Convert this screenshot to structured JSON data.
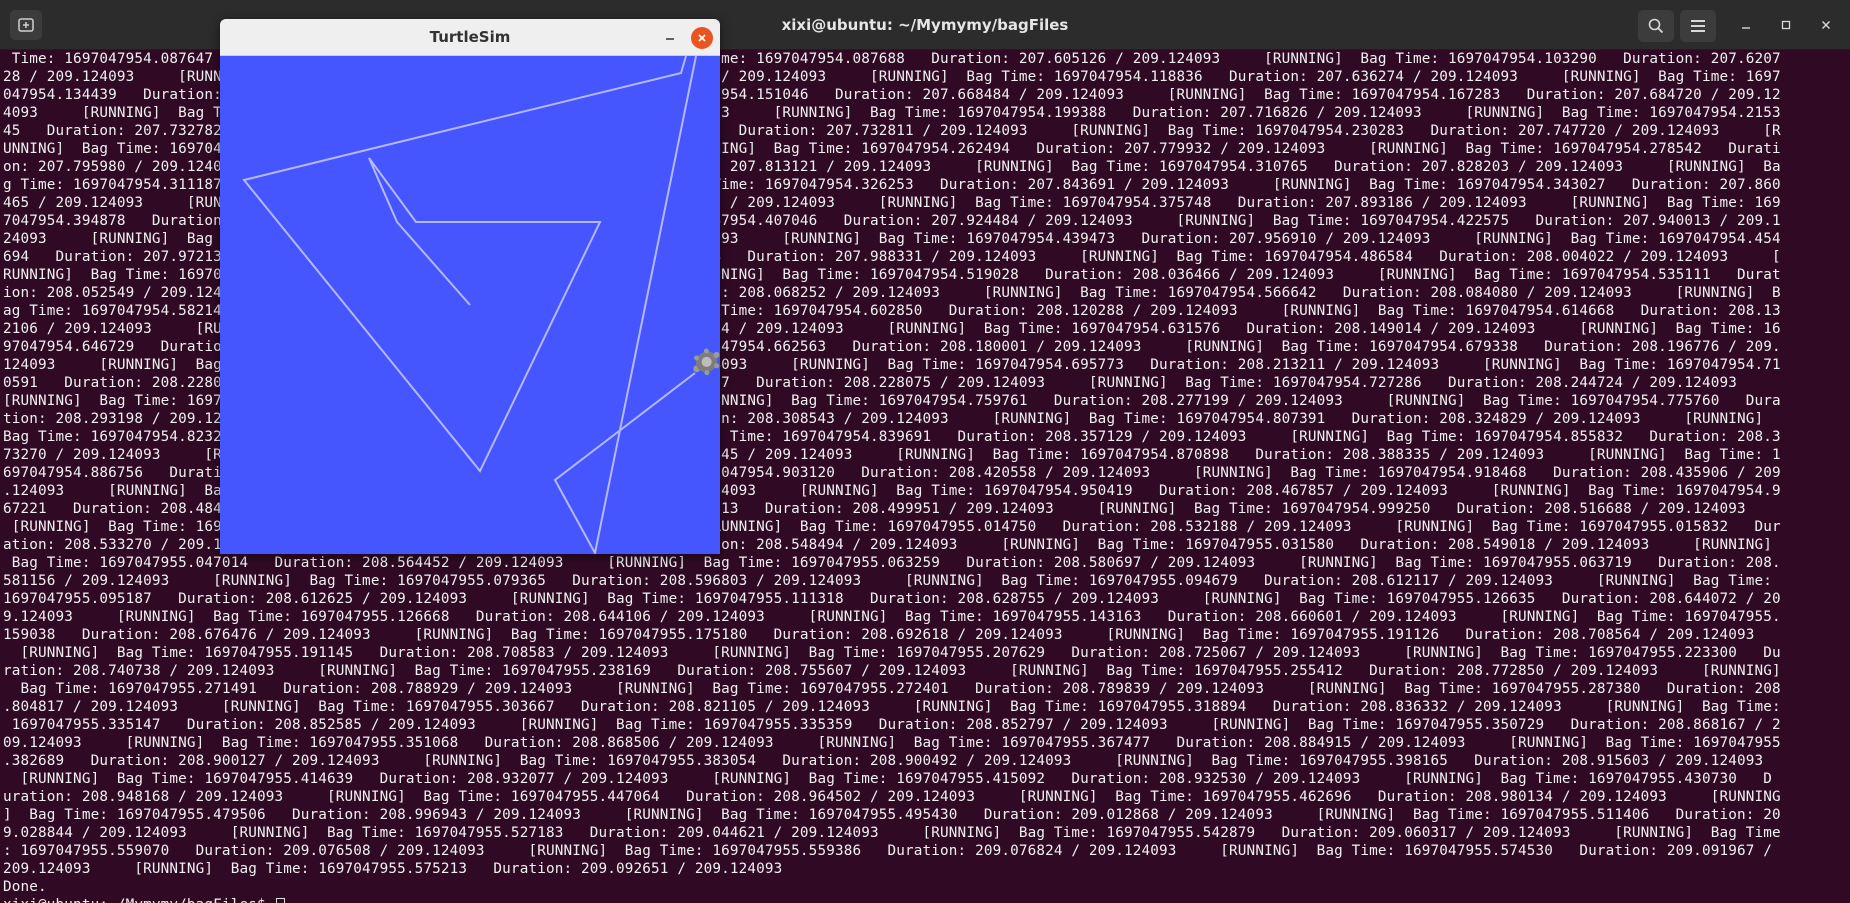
{
  "terminal": {
    "title": "xixi@ubuntu: ~/Mymymy/bagFiles",
    "icons": {
      "new_tab": "new-tab-icon",
      "search": "search-icon",
      "menu": "hamburger-menu-icon",
      "minimize": "minimize-icon",
      "maximize": "maximize-icon",
      "close": "close-icon"
    },
    "lines": [
      " Time: 1697047954.087647   Duration: 207.605126 / 209.124093     [RUNNING]  Bag Time: 1697047954.087688   Duration: 207.605126 / 209.124093     [RUNNING]  Bag Time: 1697047954.103290   Duration: 207.6207",
      "28 / 209.124093     [RUNNING]  Bag Time: 1697047954.103731   Duration: 207.620677 / 209.124093     [RUNNING]  Bag Time: 1697047954.118836   Duration: 207.636274 / 209.124093     [RUNNING]  Bag Time: 1697",
      "047954.134439   Duration: 207.651877 / 209.124093     [RUNNING]  Bag Time: 1697047954.151046   Duration: 207.668484 / 209.124093     [RUNNING]  Bag Time: 1697047954.167283   Duration: 207.684720 / 209.12",
      "4093     [RUNNING]  Bag Time: 1697047954.183442   Duration: 207.700879 / 209.124093     [RUNNING]  Bag Time: 1697047954.199388   Duration: 207.716826 / 209.124093     [RUNNING]  Bag Time: 1697047954.2153",
      "45   Duration: 207.732782 / 209.124093     [RUNNING]  Bag Time: 1697047954.215374   Duration: 207.732811 / 209.124093     [RUNNING]  Bag Time: 1697047954.230283   Duration: 207.747720 / 209.124093     [R",
      "UNNING]  Bag Time: 1697047954.246494   Duration: 207.763932 / 209.124093     [RUNNING]  Bag Time: 1697047954.262494   Duration: 207.779932 / 209.124093     [RUNNING]  Bag Time: 1697047954.278542   Durati",
      "on: 207.795980 / 209.124093     [RUNNING]  Bag Time: 1697047954.295683   Duration: 207.813121 / 209.124093     [RUNNING]  Bag Time: 1697047954.310765   Duration: 207.828203 / 209.124093     [RUNNING]  Ba",
      "g Time: 1697047954.311187   Duration: 207.828625 / 209.124093     [RUNNING]  Bag Time: 1697047954.326253   Duration: 207.843691 / 209.124093     [RUNNING]  Bag Time: 1697047954.343027   Duration: 207.860",
      "465 / 209.124093     [RUNNING]  Bag Time: 1697047954.359677   Duration: 207.877115 / 209.124093     [RUNNING]  Bag Time: 1697047954.375748   Duration: 207.893186 / 209.124093     [RUNNING]  Bag Time: 169",
      "7047954.394878   Duration: 207.912316 / 209.124093     [RUNNING]  Bag Time: 1697047954.407046   Duration: 207.924484 / 209.124093     [RUNNING]  Bag Time: 1697047954.422575   Duration: 207.940013 / 209.1",
      "24093     [RUNNING]  Bag Time: 1697047954.423124   Duration: 207.940562 / 209.124093     [RUNNING]  Bag Time: 1697047954.439473   Duration: 207.956910 / 209.124093     [RUNNING]  Bag Time: 1697047954.454",
      "694   Duration: 207.972132 / 209.124093     [RUNNING]  Bag Time: 1697047954.470894   Duration: 207.988331 / 209.124093     [RUNNING]  Bag Time: 1697047954.486584   Duration: 208.004022 / 209.124093     [",
      "RUNNING]  Bag Time: 1697047954.502598   Duration: 208.020036 / 209.124093     [RUNNING]  Bag Time: 1697047954.519028   Duration: 208.036466 / 209.124093     [RUNNING]  Bag Time: 1697047954.535111   Durat",
      "ion: 208.052549 / 209.124093     [RUNNING]  Bag Time: 1697047954.550814   Duration: 208.068252 / 209.124093     [RUNNING]  Bag Time: 1697047954.566642   Duration: 208.084080 / 209.124093     [RUNNING]  B",
      "ag Time: 1697047954.582146   Duration: 208.099584 / 209.124093     [RUNNING]  Bag Time: 1697047954.602850   Duration: 208.120288 / 209.124093     [RUNNING]  Bag Time: 1697047954.614668   Duration: 208.13",
      "2106 / 209.124093     [RUNNING]  Bag Time: 1697047954.615676   Duration: 208.133114 / 209.124093     [RUNNING]  Bag Time: 1697047954.631576   Duration: 208.149014 / 209.124093     [RUNNING]  Bag Time: 16",
      "97047954.646729   Duration: 208.164167 / 209.124093     [RUNNING]  Bag Time: 1697047954.662563   Duration: 208.180001 / 209.124093     [RUNNING]  Bag Time: 1697047954.679338   Duration: 208.196776 / 209.",
      "124093     [RUNNING]  Bag Time: 1697047954.679621   Duration: 208.197059 / 209.124093     [RUNNING]  Bag Time: 1697047954.695773   Duration: 208.213211 / 209.124093     [RUNNING]  Bag Time: 1697047954.71",
      "0591   Duration: 208.228029 / 209.124093     [RUNNING]  Bag Time: 1697047954.710637   Duration: 208.228075 / 209.124093     [RUNNING]  Bag Time: 1697047954.727286   Duration: 208.244724 / 209.124093",
      "[RUNNING]  Bag Time: 1697047954.743455   Duration: 208.260893 / 209.124093     [RUNNING]  Bag Time: 1697047954.759761   Duration: 208.277199 / 209.124093     [RUNNING]  Bag Time: 1697047954.775760   Dura",
      "tion: 208.293198 / 209.124093     [RUNNING]  Bag Time: 1697047954.791105   Duration: 208.308543 / 209.124093     [RUNNING]  Bag Time: 1697047954.807391   Duration: 208.324829 / 209.124093     [RUNNING]",
      "Bag Time: 1697047954.823288   Duration: 208.340726 / 209.124093     [RUNNING]  Bag Time: 1697047954.839691   Duration: 208.357129 / 209.124093     [RUNNING]  Bag Time: 1697047954.855832   Duration: 208.3",
      "73270 / 209.124093     [RUNNING]  Bag Time: 1697047954.870707   Duration: 208.388145 / 209.124093     [RUNNING]  Bag Time: 1697047954.870898   Duration: 208.388335 / 209.124093     [RUNNING]  Bag Time: 1",
      "697047954.886756   Duration: 208.404194 / 209.124093     [RUNNING]  Bag Time: 1697047954.903120   Duration: 208.420558 / 209.124093     [RUNNING]  Bag Time: 1697047954.918468   Duration: 208.435906 / 209",
      ".124093     [RUNNING]  Bag Time: 1697047954.934485   Duration: 208.451923 / 209.124093     [RUNNING]  Bag Time: 1697047954.950419   Duration: 208.467857 / 209.124093     [RUNNING]  Bag Time: 1697047954.9",
      "67221   Duration: 208.484659 / 209.124093     [RUNNING]  Bag Time: 1697047954.982513   Duration: 208.499951 / 209.124093     [RUNNING]  Bag Time: 1697047954.999250   Duration: 208.516688 / 209.124093",
      " [RUNNING]  Bag Time: 1697047954.999738   Duration: 208.517176 / 209.124093     [RUNNING]  Bag Time: 1697047955.014750   Duration: 208.532188 / 209.124093     [RUNNING]  Bag Time: 1697047955.015832   Dur",
      "ation: 208.533270 / 209.124093     [RUNNING]  Bag Time: 1697047955.031056   Duration: 208.548494 / 209.124093     [RUNNING]  Bag Time: 1697047955.031580   Duration: 208.549018 / 209.124093     [RUNNING]",
      " Bag Time: 1697047955.047014   Duration: 208.564452 / 209.124093     [RUNNING]  Bag Time: 1697047955.063259   Duration: 208.580697 / 209.124093     [RUNNING]  Bag Time: 1697047955.063719   Duration: 208.",
      "581156 / 209.124093     [RUNNING]  Bag Time: 1697047955.079365   Duration: 208.596803 / 209.124093     [RUNNING]  Bag Time: 1697047955.094679   Duration: 208.612117 / 209.124093     [RUNNING]  Bag Time:",
      "1697047955.095187   Duration: 208.612625 / 209.124093     [RUNNING]  Bag Time: 1697047955.111318   Duration: 208.628755 / 209.124093     [RUNNING]  Bag Time: 1697047955.126635   Duration: 208.644072 / 20",
      "9.124093     [RUNNING]  Bag Time: 1697047955.126668   Duration: 208.644106 / 209.124093     [RUNNING]  Bag Time: 1697047955.143163   Duration: 208.660601 / 209.124093     [RUNNING]  Bag Time: 1697047955.",
      "159038   Duration: 208.676476 / 209.124093     [RUNNING]  Bag Time: 1697047955.175180   Duration: 208.692618 / 209.124093     [RUNNING]  Bag Time: 1697047955.191126   Duration: 208.708564 / 209.124093",
      "  [RUNNING]  Bag Time: 1697047955.191145   Duration: 208.708583 / 209.124093     [RUNNING]  Bag Time: 1697047955.207629   Duration: 208.725067 / 209.124093     [RUNNING]  Bag Time: 1697047955.223300   Du",
      "ration: 208.740738 / 209.124093     [RUNNING]  Bag Time: 1697047955.238169   Duration: 208.755607 / 209.124093     [RUNNING]  Bag Time: 1697047955.255412   Duration: 208.772850 / 209.124093     [RUNNING]",
      "  Bag Time: 1697047955.271491   Duration: 208.788929 / 209.124093     [RUNNING]  Bag Time: 1697047955.272401   Duration: 208.789839 / 209.124093     [RUNNING]  Bag Time: 1697047955.287380   Duration: 208",
      ".804817 / 209.124093     [RUNNING]  Bag Time: 1697047955.303667   Duration: 208.821105 / 209.124093     [RUNNING]  Bag Time: 1697047955.318894   Duration: 208.836332 / 209.124093     [RUNNING]  Bag Time:",
      " 1697047955.335147   Duration: 208.852585 / 209.124093     [RUNNING]  Bag Time: 1697047955.335359   Duration: 208.852797 / 209.124093     [RUNNING]  Bag Time: 1697047955.350729   Duration: 208.868167 / 2",
      "09.124093     [RUNNING]  Bag Time: 1697047955.351068   Duration: 208.868506 / 209.124093     [RUNNING]  Bag Time: 1697047955.367477   Duration: 208.884915 / 209.124093     [RUNNING]  Bag Time: 1697047955",
      ".382689   Duration: 208.900127 / 209.124093     [RUNNING]  Bag Time: 1697047955.383054   Duration: 208.900492 / 209.124093     [RUNNING]  Bag Time: 1697047955.398165   Duration: 208.915603 / 209.124093",
      "  [RUNNING]  Bag Time: 1697047955.414639   Duration: 208.932077 / 209.124093     [RUNNING]  Bag Time: 1697047955.415092   Duration: 208.932530 / 209.124093     [RUNNING]  Bag Time: 1697047955.430730   D",
      "uration: 208.948168 / 209.124093     [RUNNING]  Bag Time: 1697047955.447064   Duration: 208.964502 / 209.124093     [RUNNING]  Bag Time: 1697047955.462696   Duration: 208.980134 / 209.124093     [RUNNING",
      "]  Bag Time: 1697047955.479506   Duration: 208.996943 / 209.124093     [RUNNING]  Bag Time: 1697047955.495430   Duration: 209.012868 / 209.124093     [RUNNING]  Bag Time: 1697047955.511406   Duration: 20",
      "9.028844 / 209.124093     [RUNNING]  Bag Time: 1697047955.527183   Duration: 209.044621 / 209.124093     [RUNNING]  Bag Time: 1697047955.542879   Duration: 209.060317 / 209.124093     [RUNNING]  Bag Time",
      ": 1697047955.559070   Duration: 209.076508 / 209.124093     [RUNNING]  Bag Time: 1697047955.559386   Duration: 209.076824 / 209.124093     [RUNNING]  Bag Time: 1697047955.574530   Duration: 209.091967 /",
      "209.124093     [RUNNING]  Bag Time: 1697047955.575213   Duration: 209.092651 / 209.124093",
      "Done.",
      "xixi@ubuntu:~/Mymymy/bagFiles$ "
    ]
  },
  "turtlesim": {
    "title": "TurtleSim",
    "background_color": "#4556ff",
    "pen_color": "#b3b8ff",
    "close_color": "#e95420",
    "icons": {
      "minimize": "minimize-icon",
      "close": "close-icon",
      "turtle": "turtle-icon"
    }
  }
}
